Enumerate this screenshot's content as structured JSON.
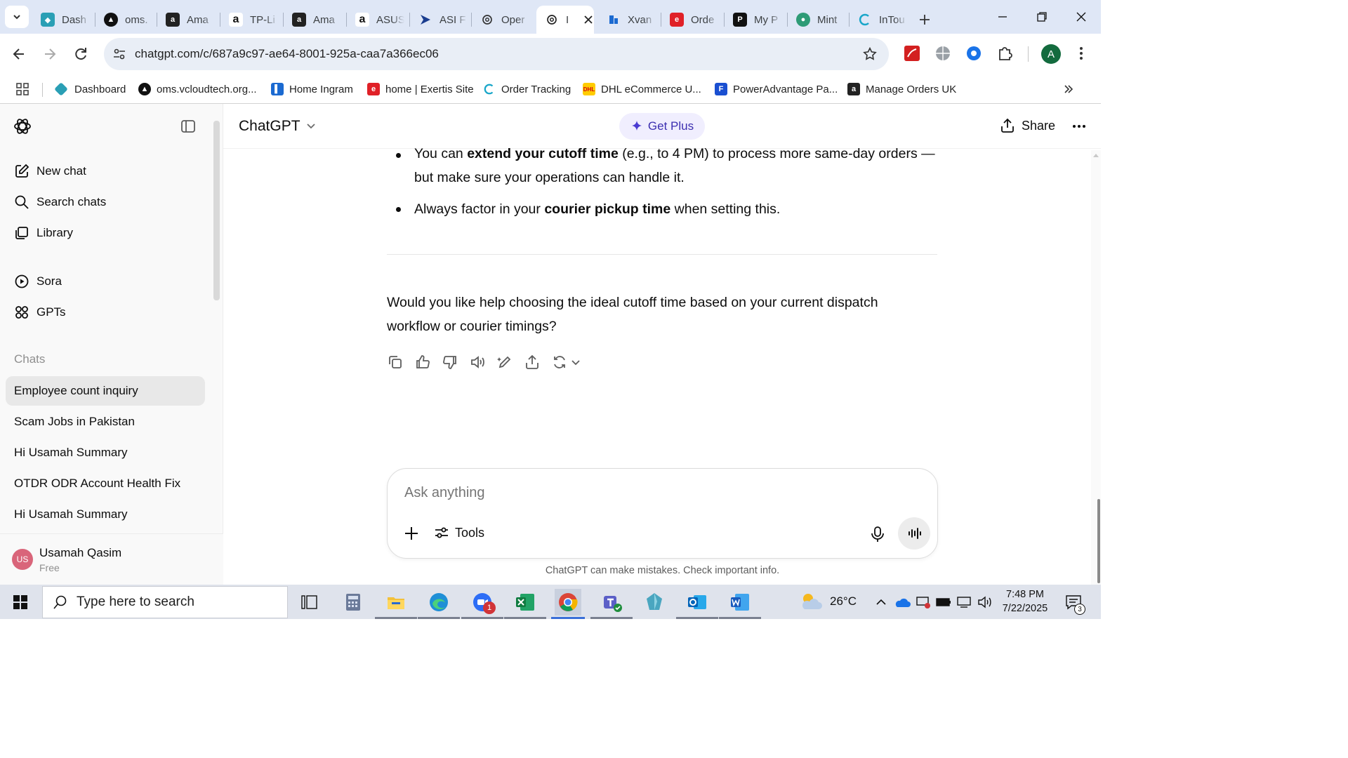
{
  "browser": {
    "tabs": [
      {
        "label": "Dash",
        "icon": "dashboard-icon",
        "color": "#2a9fb5"
      },
      {
        "label": "oms.",
        "icon": "oms-icon",
        "color": "#111111"
      },
      {
        "label": "Ama",
        "icon": "amazon-icon",
        "color": "#222222"
      },
      {
        "label": "TP-Li",
        "icon": "amazon-icon",
        "color": "#ffffff"
      },
      {
        "label": "Ama",
        "icon": "amazon-icon",
        "color": "#222222"
      },
      {
        "label": "ASUS",
        "icon": "amazon-icon",
        "color": "#ffffff"
      },
      {
        "label": "ASI F",
        "icon": "asi-icon",
        "color": "#1a3d8f"
      },
      {
        "label": "Oper",
        "icon": "openai-icon",
        "color": "#ffffff"
      },
      {
        "label": "I",
        "icon": "openai-icon",
        "color": "#ffffff"
      },
      {
        "label": "Xvan",
        "icon": "xvantage-icon",
        "color": "#1b6ad1"
      },
      {
        "label": "Orde",
        "icon": "exertis-icon",
        "color": "#e02027"
      },
      {
        "label": "My P",
        "icon": "myp-icon",
        "color": "#111111"
      },
      {
        "label": "Mint",
        "icon": "mint-icon",
        "color": "#2e9b76"
      },
      {
        "label": "InTou",
        "icon": "intouch-icon",
        "color": "#19a6c9"
      }
    ],
    "url": "chatgpt.com/c/687a9c97-ae64-8001-925a-caa7a366ec06",
    "profile_initial": "A",
    "bookmarks": [
      {
        "label": "Dashboard",
        "icon": "dashboard-icon"
      },
      {
        "label": "oms.vcloudtech.org...",
        "icon": "oms-icon"
      },
      {
        "label": "Home Ingram",
        "icon": "ingram-icon"
      },
      {
        "label": "home | Exertis Site",
        "icon": "exertis-icon"
      },
      {
        "label": "Order Tracking",
        "icon": "order-tracking-icon"
      },
      {
        "label": "DHL eCommerce U...",
        "icon": "dhl-icon"
      },
      {
        "label": "PowerAdvantage Pa...",
        "icon": "poweradvantage-icon"
      },
      {
        "label": "Manage Orders UK",
        "icon": "amazon-icon"
      }
    ]
  },
  "sidebar": {
    "nav": [
      {
        "label": "New chat",
        "icon": "new-chat-icon"
      },
      {
        "label": "Search chats",
        "icon": "search-icon"
      },
      {
        "label": "Library",
        "icon": "library-icon"
      },
      {
        "label": "Sora",
        "icon": "sora-icon"
      },
      {
        "label": "GPTs",
        "icon": "gpts-icon"
      }
    ],
    "chats_heading": "Chats",
    "chats": [
      "Employee count inquiry",
      "Scam Jobs in Pakistan",
      "Hi Usamah Summary",
      "OTDR ODR Account Health Fix",
      "Hi Usamah Summary"
    ],
    "user": {
      "initials": "US",
      "name": "Usamah Qasim",
      "plan": "Free"
    }
  },
  "header": {
    "title": "ChatGPT",
    "get_plus": "Get Plus",
    "share": "Share"
  },
  "conversation": {
    "bullet1": {
      "a": "You can ",
      "b": "extend your cutoff time",
      "c": " (e.g., to 4 PM) to process more same-day orders —",
      "d": "but make sure your operations can handle it."
    },
    "bullet2": {
      "a": "Always factor in your ",
      "b": "courier pickup time",
      "c": " when setting this."
    },
    "question_line1": "Would you like help choosing the ideal cutoff time based on your current dispatch",
    "question_line2": "workflow or courier timings?"
  },
  "composer": {
    "placeholder": "Ask anything",
    "tools": "Tools",
    "disclaimer": "ChatGPT can make mistakes. Check important info."
  },
  "taskbar": {
    "search_placeholder": "Type here to search",
    "weather": "26°C",
    "time": "7:48 PM",
    "date": "7/22/2025",
    "zoom_badge": "1",
    "notifications": "3"
  }
}
